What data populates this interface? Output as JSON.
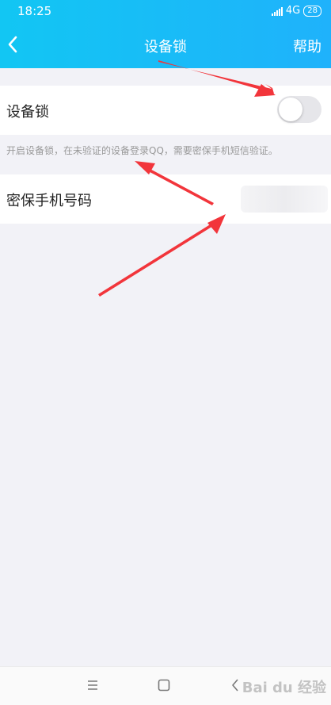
{
  "status_bar": {
    "time": "18:25",
    "network": "4G",
    "battery": "28"
  },
  "nav": {
    "title": "设备锁",
    "help_label": "帮助"
  },
  "settings": {
    "device_lock_label": "设备锁",
    "device_lock_enabled": false,
    "hint": "开启设备锁，在未验证的设备登录QQ，需要密保手机短信验证。",
    "phone_label": "密保手机号码"
  },
  "watermark": {
    "text": "Bai du 经验"
  },
  "colors": {
    "header_start": "#12c6f3",
    "header_end": "#1fb2fb",
    "annotation_arrow": "#f2353b"
  }
}
